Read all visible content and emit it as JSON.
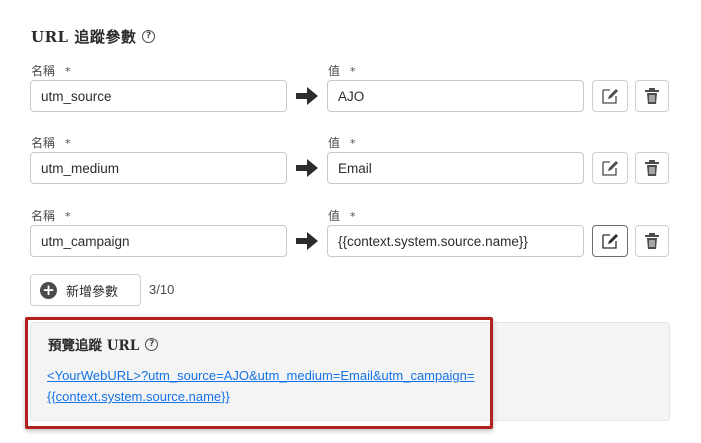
{
  "section": {
    "title": "URL 追蹤參數",
    "help_icon": "help-circle-icon"
  },
  "params": [
    {
      "name_label": "名稱",
      "name_value": "utm_source",
      "value_label": "值",
      "value_value": "AJO"
    },
    {
      "name_label": "名稱",
      "name_value": "utm_medium",
      "value_label": "值",
      "value_value": "Email"
    },
    {
      "name_label": "名稱",
      "name_value": "utm_campaign",
      "value_label": "值",
      "value_value": "{{context.system.source.name}}"
    }
  ],
  "required_marker": "*",
  "add_param": {
    "label": "新增參數",
    "count": "3/10"
  },
  "preview": {
    "title": "預覽追蹤 URL",
    "url_line1": "<YourWebURL>?utm_source=AJO&utm_medium=Email&utm_campaign=",
    "url_line2": "{{context.system.source.name}}"
  },
  "colors": {
    "link": "#1473e6",
    "highlight": "#b3211e",
    "panel": "#f4f4f4"
  }
}
